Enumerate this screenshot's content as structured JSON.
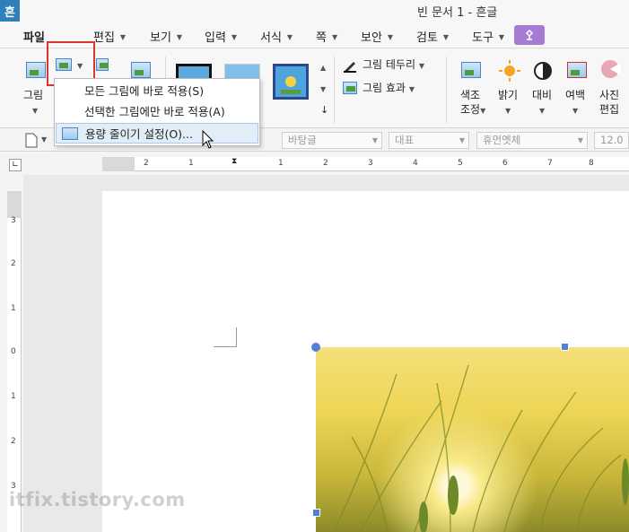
{
  "window": {
    "app_logo": "흔",
    "title": "빈 문서 1 - 흔글"
  },
  "menu": {
    "file": "파일",
    "items": [
      "편집",
      "보기",
      "입력",
      "서식",
      "쪽",
      "보안",
      "검토",
      "도구"
    ]
  },
  "ribbon": {
    "picture_label": "그림",
    "border_label": "그림 테두리",
    "effect_label": "그림 효과",
    "color_label_1": "색조",
    "color_label_2": "조정",
    "brightness_label": "밝기",
    "contrast_label": "대비",
    "margin_label": "여백",
    "photo_edit_1": "사진",
    "photo_edit_2": "편집"
  },
  "dropdown": {
    "items": [
      "모든 그림에 바로 적용(S)",
      "선택한 그림에만 바로 적용(A)",
      "용량 줄이기 설정(O)..."
    ]
  },
  "format_bar": {
    "font_face": "바탕글",
    "language": "대표",
    "font": "휴먼옛체",
    "size": "12.0"
  },
  "ruler": {
    "h_numbers": [
      "2",
      "1",
      "1",
      "2",
      "3",
      "4",
      "5",
      "6",
      "7",
      "8"
    ],
    "v_numbers": [
      "3",
      "2",
      "1",
      "0",
      "1",
      "2",
      "3"
    ]
  },
  "watermark": "itfix.tistory.com"
}
